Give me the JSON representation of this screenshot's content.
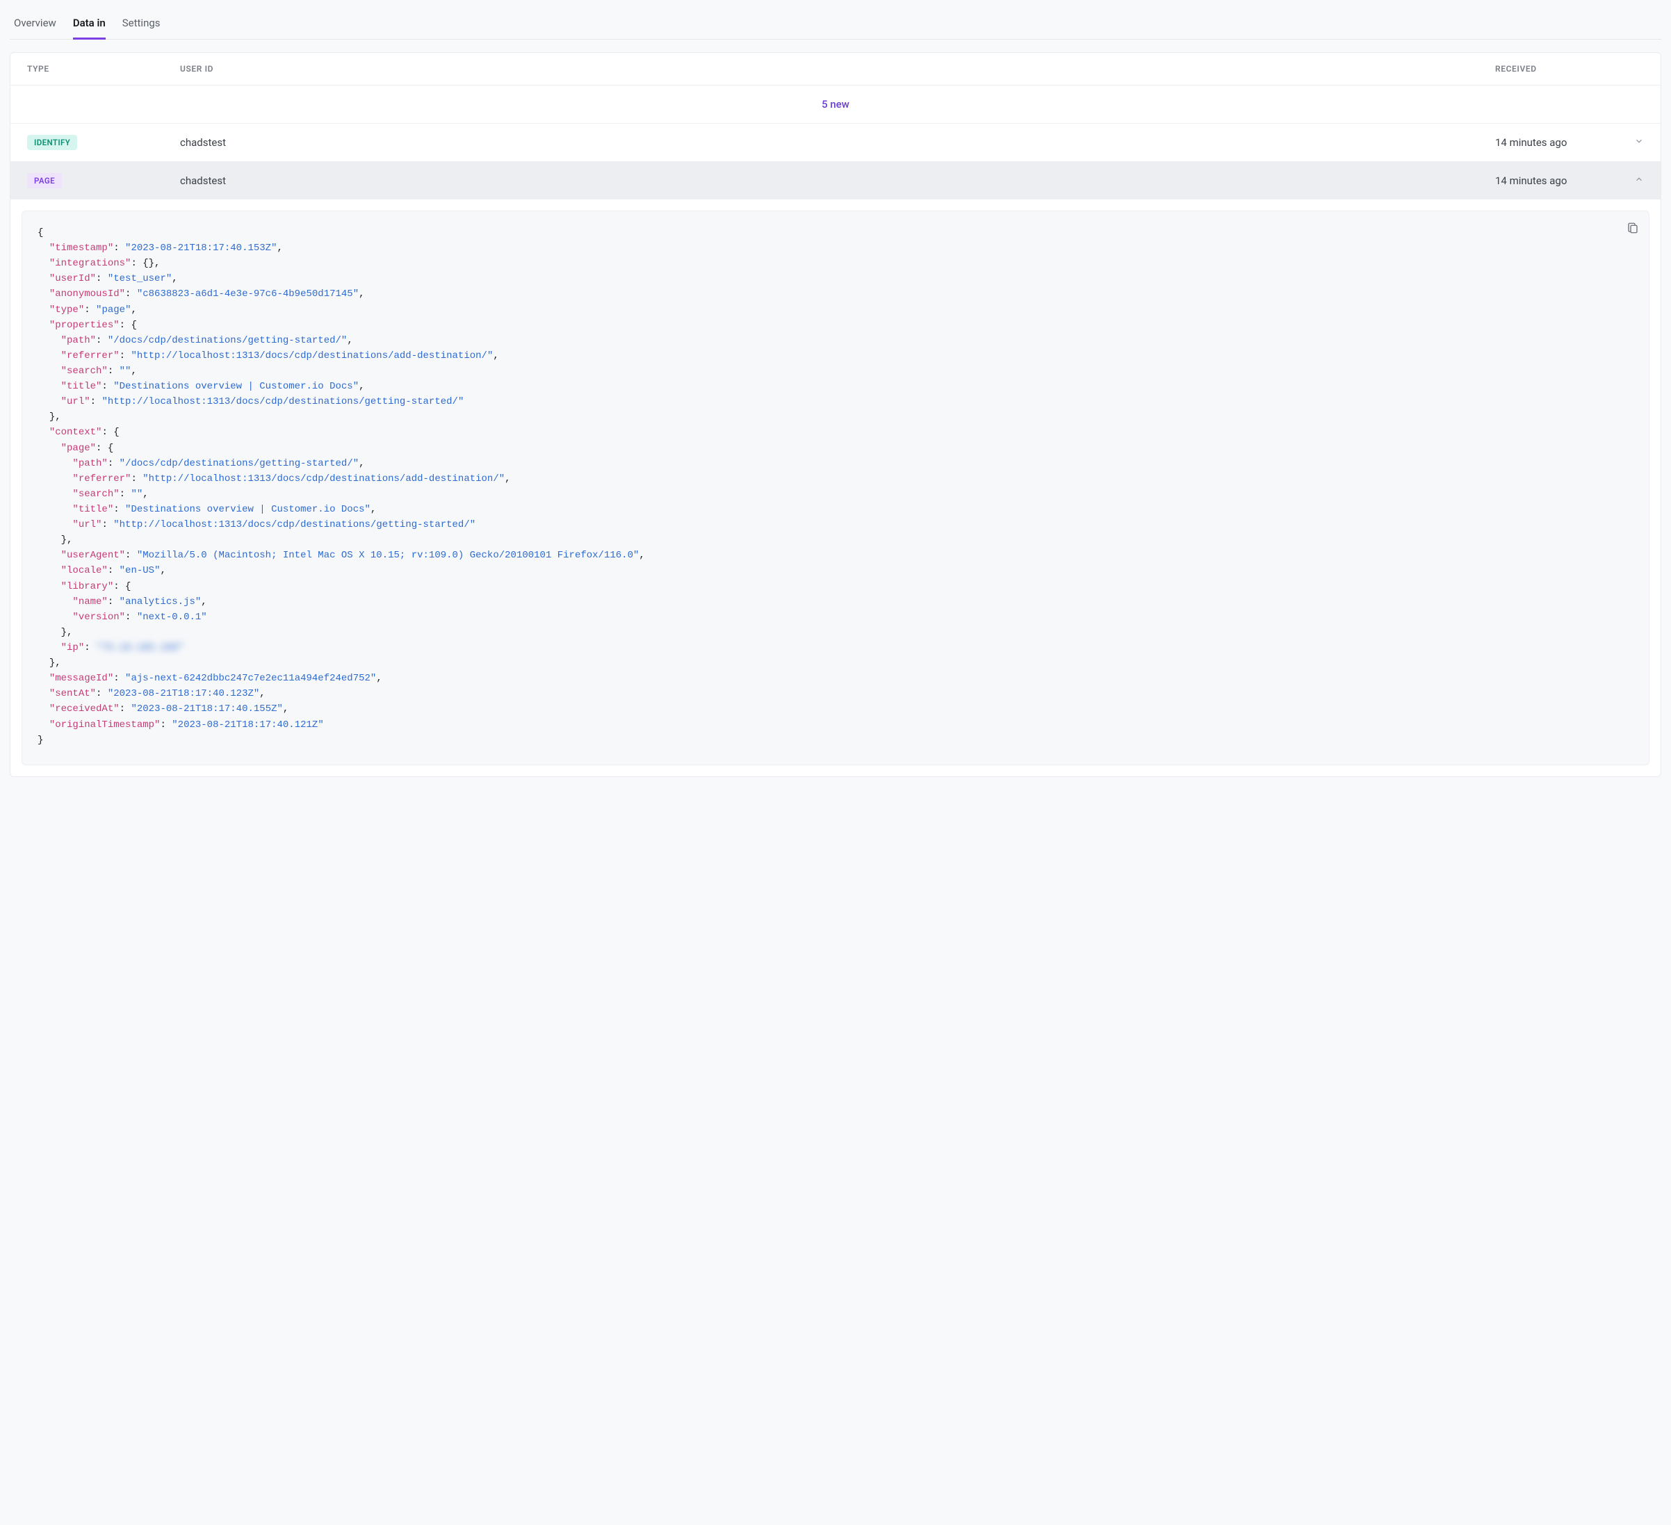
{
  "tabs": [
    {
      "label": "Overview",
      "active": false
    },
    {
      "label": "Data in",
      "active": true
    },
    {
      "label": "Settings",
      "active": false
    }
  ],
  "columns": {
    "type": "TYPE",
    "user": "USER ID",
    "received": "RECEIVED"
  },
  "new_banner": "5 new",
  "rows": [
    {
      "badge": "IDENTIFY",
      "badgeClass": "badge-identify",
      "userId": "chadstest",
      "received": "14 minutes ago",
      "expanded": false
    },
    {
      "badge": "PAGE",
      "badgeClass": "badge-page",
      "userId": "chadstest",
      "received": "14 minutes ago",
      "expanded": true
    }
  ],
  "payload": {
    "timestamp": "2023-08-21T18:17:40.153Z",
    "integrations": {},
    "userId": "test_user",
    "anonymousId": "c8638823-a6d1-4e3e-97c6-4b9e50d17145",
    "type": "page",
    "properties": {
      "path": "/docs/cdp/destinations/getting-started/",
      "referrer": "http://localhost:1313/docs/cdp/destinations/add-destination/",
      "search": "",
      "title": "Destinations overview | Customer.io Docs",
      "url": "http://localhost:1313/docs/cdp/destinations/getting-started/"
    },
    "context": {
      "page": {
        "path": "/docs/cdp/destinations/getting-started/",
        "referrer": "http://localhost:1313/docs/cdp/destinations/add-destination/",
        "search": "",
        "title": "Destinations overview | Customer.io Docs",
        "url": "http://localhost:1313/docs/cdp/destinations/getting-started/"
      },
      "userAgent": "Mozilla/5.0 (Macintosh; Intel Mac OS X 10.15; rv:109.0) Gecko/20100101 Firefox/116.0",
      "locale": "en-US",
      "library": {
        "name": "analytics.js",
        "version": "next-0.0.1"
      },
      "ip": "75.10.105.100"
    },
    "messageId": "ajs-next-6242dbbc247c7e2ec11a494ef24ed752",
    "sentAt": "2023-08-21T18:17:40.123Z",
    "receivedAt": "2023-08-21T18:17:40.155Z",
    "originalTimestamp": "2023-08-21T18:17:40.121Z"
  }
}
